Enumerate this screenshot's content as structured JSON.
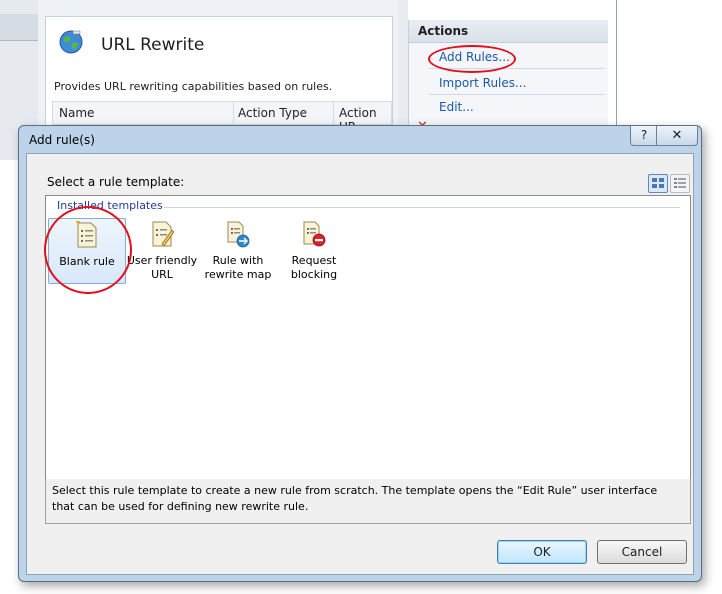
{
  "background": {
    "feature_title": "URL Rewrite",
    "feature_description": "Provides URL rewriting capabilities based on rules.",
    "grid_columns": [
      "Name",
      "Action Type",
      "Action UR"
    ],
    "actions_header": "Actions",
    "actions": [
      {
        "label": "Add Rules..."
      },
      {
        "label": "Import Rules..."
      },
      {
        "label": "Edit..."
      }
    ]
  },
  "dialog": {
    "title": "Add rule(s)",
    "help_label": "?",
    "close_label": "✕",
    "select_label": "Select a rule template:",
    "group_label": "Installed templates",
    "templates": [
      {
        "label": "Blank rule",
        "icon": "blank-rule-icon",
        "selected": true
      },
      {
        "label": "User friendly\nURL",
        "icon": "user-friendly-url-icon",
        "selected": false
      },
      {
        "label": "Rule with\nrewrite map",
        "icon": "rewrite-map-icon",
        "selected": false
      },
      {
        "label": "Request\nblocking",
        "icon": "request-blocking-icon",
        "selected": false
      }
    ],
    "description": "Select this rule template to create a new rule from scratch. The template opens the “Edit Rule” user interface that can be used for defining new rewrite rule.",
    "ok_label": "OK",
    "cancel_label": "Cancel"
  },
  "colors": {
    "link": "#1a5aa6",
    "annotation": "#e0101e",
    "dialog_frame": "#bcd3ea",
    "group_label": "#1f3d98"
  }
}
